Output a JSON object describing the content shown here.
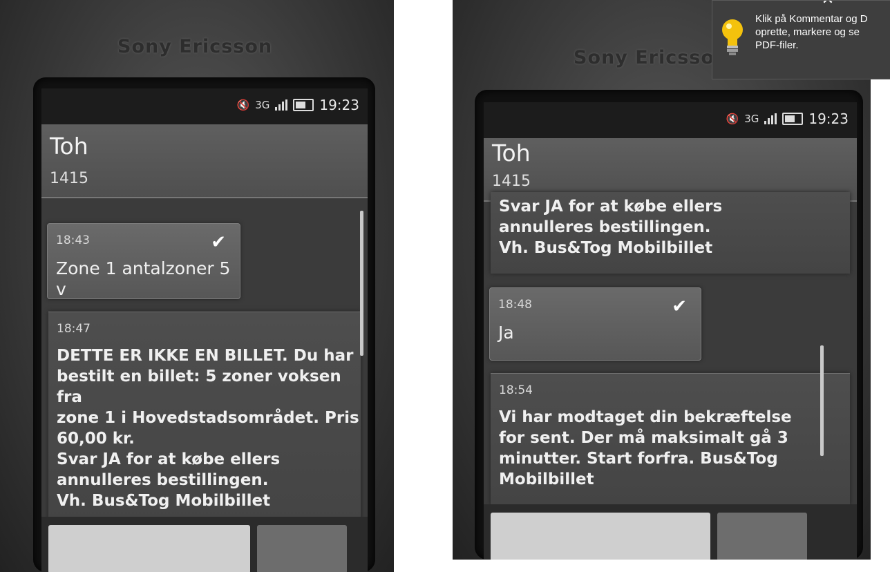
{
  "brand": "Sony Ericsson",
  "tooltip": {
    "lines": [
      "Klik på Kommentar og D",
      "oprette, markere og se",
      "PDF-filer."
    ],
    "close_icon": "close-icon",
    "icon": "lightbulb-icon"
  },
  "left": {
    "status": {
      "time": "19:23",
      "network": "3G"
    },
    "contact": {
      "name": "Toh",
      "number": "1415"
    },
    "messages": [
      {
        "type": "sent",
        "time": "18:43",
        "body": "Zone 1 antalzoner 5 v",
        "delivered": true
      },
      {
        "type": "received",
        "time": "18:47",
        "body": "DETTE ER IKKE EN BILLET. Du har\nbestilt en billet: 5 zoner voksen fra\nzone 1 i Hovedstadsområdet. Pris\n60,00 kr.\nSvar JA for at købe ellers\nannulleres bestillingen.\nVh. Bus&Tog Mobilbillet"
      }
    ]
  },
  "right": {
    "status": {
      "time": "19:23",
      "network": "3G"
    },
    "contact": {
      "name": "Toh",
      "number": "1415"
    },
    "messages": [
      {
        "type": "received",
        "time": "",
        "body": "Svar JA for at købe ellers\nannulleres bestillingen.\nVh. Bus&Tog Mobilbillet"
      },
      {
        "type": "sent",
        "time": "18:48",
        "body": "Ja",
        "delivered": true
      },
      {
        "type": "received",
        "time": "18:54",
        "body": "Vi har modtaget din bekræftelse\nfor sent. Der må maksimalt gå 3\nminutter. Start forfra. Bus&Tog\nMobilbillet"
      }
    ]
  }
}
